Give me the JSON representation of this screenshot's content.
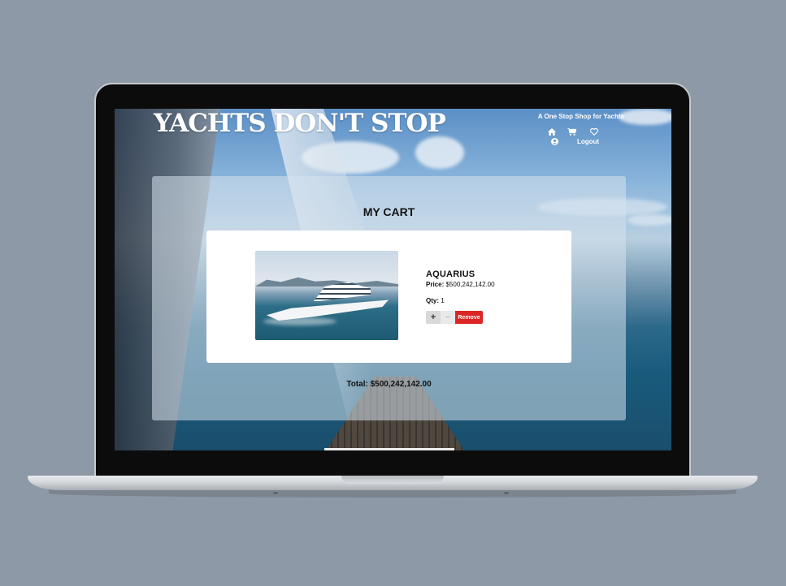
{
  "header": {
    "brand": "YACHTS DON'T STOP",
    "tagline": "A One Stop Shop for Yachts",
    "nav": {
      "home_icon": "home-icon",
      "cart_icon": "cart-icon",
      "wishlist_icon": "heart-icon",
      "profile_icon": "user-circle-icon",
      "logout_label": "Logout"
    }
  },
  "cart": {
    "title": "MY CART",
    "items": [
      {
        "name": "AQUARIUS",
        "price_label": "Price:",
        "price": "$500,242,142.00",
        "qty_label": "Qty:",
        "qty": "1",
        "plus_label": "+",
        "minus_label": "−",
        "remove_label": "Remove"
      }
    ],
    "total_label": "Total:",
    "total": "$500,242,142.00"
  },
  "colors": {
    "page_background": "#8d99a6",
    "remove_button": "#dc2626",
    "panel": "rgba(214,226,236,0.55)"
  }
}
